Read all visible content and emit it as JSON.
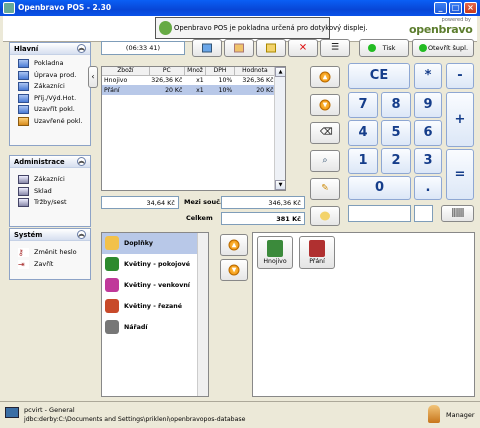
{
  "window": {
    "title": "Openbravo POS - 2.30",
    "min": "_",
    "max": "□",
    "close": "×"
  },
  "banner": {
    "message": "Openbravo POS je pokladna určená pro dotykový displej.",
    "powered_by": "powered by",
    "brand": "openbravo"
  },
  "nav": {
    "sections": [
      {
        "title": "Hlavní",
        "items": [
          {
            "label": "Pokladna",
            "icon": "register-icon"
          },
          {
            "label": "Úprava prod.",
            "icon": "edit-sales-icon"
          },
          {
            "label": "Zákazníci",
            "icon": "customers-icon"
          },
          {
            "label": "Příj./Výd.Hot.",
            "icon": "cash-in-out-icon"
          },
          {
            "label": "Uzavřít pokl.",
            "icon": "close-cash-icon"
          },
          {
            "label": "Uzavřené pokl.",
            "icon": "closed-cash-icon"
          }
        ]
      },
      {
        "title": "Administrace",
        "items": [
          {
            "label": "Zákazníci",
            "icon": "customers-book-icon"
          },
          {
            "label": "Sklad",
            "icon": "stock-book-icon"
          },
          {
            "label": "Tržby/sest",
            "icon": "sales-book-icon"
          }
        ]
      },
      {
        "title": "Systém",
        "items": [
          {
            "label": "Změnit heslo",
            "icon": "key-icon"
          },
          {
            "label": "Zavřít",
            "icon": "exit-icon"
          }
        ]
      }
    ]
  },
  "ticket": {
    "id": "(06:33 41)",
    "columns": [
      "Zboží",
      "PC",
      "Množ",
      "DPH",
      "Hodnota"
    ],
    "rows": [
      {
        "item": "Hnojivo",
        "price": "326,36 Kč",
        "qty": "x1",
        "tax": "10%",
        "value": "326,36 Kč"
      },
      {
        "item": "Přání",
        "price": "20 Kč",
        "qty": "x1",
        "tax": "10%",
        "value": "20 Kč"
      }
    ],
    "tax_total": "34,64 Kč",
    "subtotal_label": "Mezi souč.",
    "subtotal": "346,36 Kč",
    "total_label": "Celkem",
    "total": "381 Kč"
  },
  "actions": {
    "print": "Tisk",
    "open_drawer": "Otevřít šupl."
  },
  "keypad": {
    "ce": "CE",
    "multiply": "*",
    "minus": "-",
    "plus": "+",
    "equals": "=",
    "dot": ".",
    "digits": [
      "7",
      "8",
      "9",
      "4",
      "5",
      "6",
      "1",
      "2",
      "3",
      "0"
    ]
  },
  "categories": [
    {
      "label": "Doplňky",
      "icon": "accessories-icon",
      "color": "#f2c14a"
    },
    {
      "label": "Květiny - pokojové",
      "icon": "indoor-plant-icon",
      "color": "#2d8a2d"
    },
    {
      "label": "Květiny - venkovní",
      "icon": "outdoor-flower-icon",
      "color": "#c0399a"
    },
    {
      "label": "Květiny - řezané",
      "icon": "cut-flower-icon",
      "color": "#c84a2a"
    },
    {
      "label": "Nářadí",
      "icon": "tools-icon",
      "color": "#777777"
    }
  ],
  "products": [
    {
      "label": "Hnojivo",
      "icon": "fertilizer-icon",
      "color": "#3b8a3b"
    },
    {
      "label": "Přání",
      "icon": "greeting-card-icon",
      "color": "#b03030"
    }
  ],
  "status": {
    "host": "pcvirt - General",
    "db": "jdbc:derby:C:\\Documents and Settings\\prikleni\\openbravopos-database",
    "user": "Manager"
  }
}
